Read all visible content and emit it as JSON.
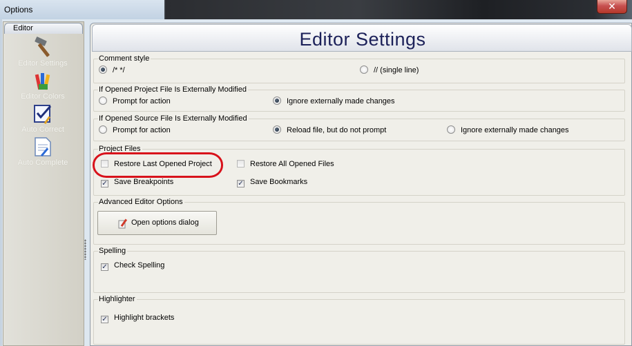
{
  "window": {
    "title": "Options",
    "close_label": "✕"
  },
  "sidebar": {
    "tab_label": "Editor",
    "items": [
      {
        "label": "Editor Settings",
        "icon": "hammer-icon"
      },
      {
        "label": "Editor Colors",
        "icon": "crayons-icon"
      },
      {
        "label": "Auto Correct",
        "icon": "checklist-icon"
      },
      {
        "label": "Auto Complete",
        "icon": "document-pen-icon"
      }
    ]
  },
  "header": {
    "title": "Editor Settings"
  },
  "comment_style": {
    "title": "Comment style",
    "options": [
      {
        "label": "/* */",
        "selected": true
      },
      {
        "label": "// (single line)",
        "selected": false
      }
    ]
  },
  "project_modified": {
    "title": "If Opened Project File Is Externally Modified",
    "options": [
      {
        "label": "Prompt for action",
        "selected": false
      },
      {
        "label": "Ignore externally made changes",
        "selected": true
      }
    ]
  },
  "source_modified": {
    "title": "If Opened Source File Is Externally Modified",
    "options": [
      {
        "label": "Prompt for action",
        "selected": false
      },
      {
        "label": "Reload file, but do not prompt",
        "selected": true
      },
      {
        "label": "Ignore externally made changes",
        "selected": false
      }
    ]
  },
  "project_files": {
    "title": "Project Files",
    "options": [
      {
        "label": "Restore Last Opened Project",
        "checked": false
      },
      {
        "label": "Restore All Opened Files",
        "checked": false
      },
      {
        "label": "Save Breakpoints",
        "checked": true
      },
      {
        "label": "Save Bookmarks",
        "checked": true
      }
    ]
  },
  "advanced": {
    "title": "Advanced Editor Options",
    "button_label": "Open options dialog"
  },
  "spelling": {
    "title": "Spelling",
    "options": [
      {
        "label": "Check Spelling",
        "checked": true
      }
    ]
  },
  "highlighter": {
    "title": "Highlighter",
    "options": [
      {
        "label": "Highlight brackets",
        "checked": true
      }
    ]
  },
  "colors": {
    "highlight_oval": "#d8121b",
    "header_title": "#1c2159"
  }
}
